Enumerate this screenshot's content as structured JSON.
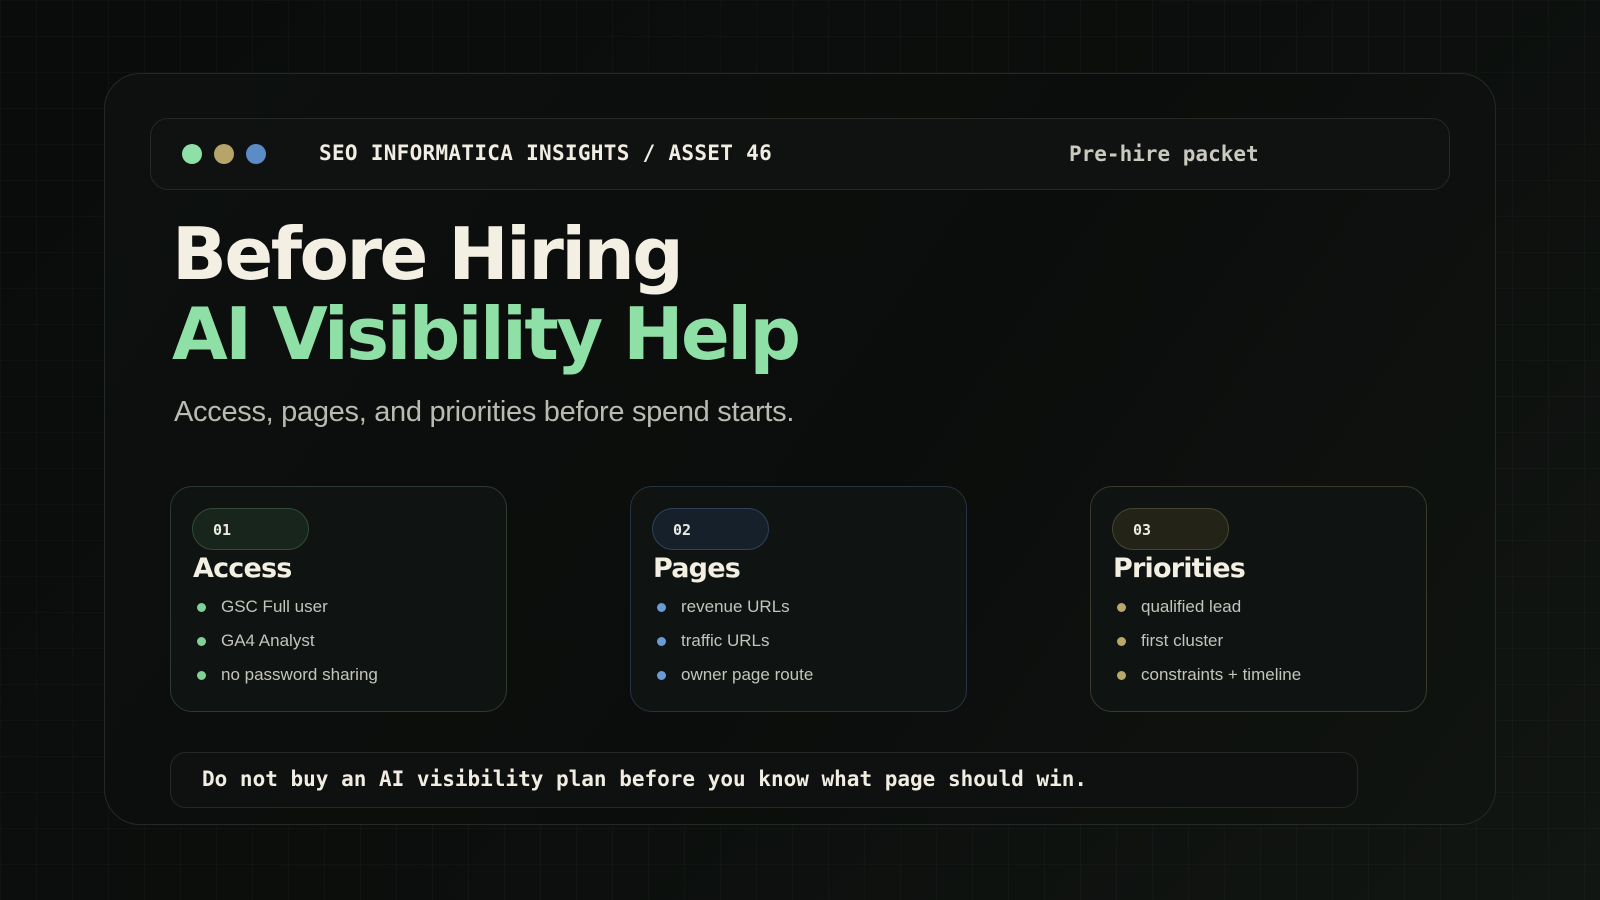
{
  "colors": {
    "dot_green": "#8fe0a6",
    "dot_gold": "#b6a46a",
    "dot_blue": "#5b8cc6",
    "accent_green": "#8fe0a6",
    "bullet_green": "#7fd195",
    "bullet_blue": "#6b9bd6",
    "bullet_gold": "#b8a86a"
  },
  "header": {
    "brand": "SEO INFORMATICA INSIGHTS / ASSET 46",
    "tag": "Pre-hire packet"
  },
  "hero": {
    "title_line1": "Before Hiring",
    "title_line2": "AI Visibility Help",
    "subtitle": "Access, pages, and priorities before spend starts."
  },
  "cards": [
    {
      "number": "01",
      "title": "Access",
      "items": [
        "GSC Full user",
        "GA4 Analyst",
        "no password sharing"
      ]
    },
    {
      "number": "02",
      "title": "Pages",
      "items": [
        "revenue URLs",
        "traffic URLs",
        "owner page route"
      ]
    },
    {
      "number": "03",
      "title": "Priorities",
      "items": [
        "qualified lead",
        "first cluster",
        "constraints + timeline"
      ]
    }
  ],
  "footer": {
    "text": "Do not buy an AI visibility plan before you know what page should win."
  }
}
